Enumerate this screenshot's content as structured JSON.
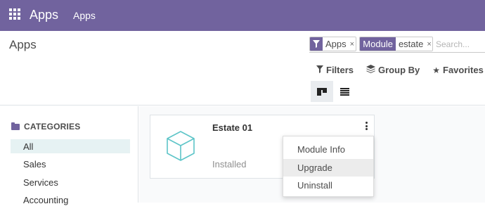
{
  "navbar": {
    "brand": "Apps",
    "menu_item": "Apps",
    "background": "#71639e",
    "apps_icon": "grid-icon"
  },
  "breadcrumb": "Apps",
  "search": {
    "facets": [
      {
        "label_icon": "filter-icon",
        "value": "Apps"
      },
      {
        "label": "Module",
        "value": "estate"
      }
    ],
    "remove_symbol": "×",
    "placeholder": "Search..."
  },
  "control_buttons": {
    "filters": "Filters",
    "group_by": "Group By",
    "favorites": "Favorites"
  },
  "views": [
    "kanban",
    "list"
  ],
  "active_view": "kanban",
  "sidebar": {
    "header": "CATEGORIES",
    "items": [
      "All",
      "Sales",
      "Services",
      "Accounting"
    ],
    "active_item": "All"
  },
  "card": {
    "title": "Estate 01",
    "status": "Installed",
    "icon": "cube-icon",
    "icon_color": "#5dc5c8"
  },
  "dropdown": {
    "items": [
      "Module Info",
      "Upgrade",
      "Uninstall"
    ],
    "hovered_item": "Upgrade"
  }
}
